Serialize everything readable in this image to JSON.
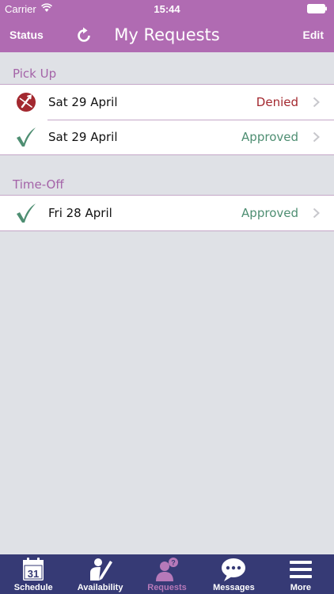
{
  "status_bar": {
    "carrier": "Carrier",
    "time": "15:44"
  },
  "nav": {
    "left_label": "Status",
    "title": "My Requests",
    "right_label": "Edit"
  },
  "sections": [
    {
      "title": "Pick Up",
      "rows": [
        {
          "date": "Sat 29 April",
          "status": "Denied",
          "icon": "denied-icon"
        },
        {
          "date": "Sat 29 April",
          "status": "Approved",
          "icon": "checkmark-icon"
        }
      ]
    },
    {
      "title": "Time-Off",
      "rows": [
        {
          "date": "Fri 28 April",
          "status": "Approved",
          "icon": "checkmark-icon"
        }
      ]
    }
  ],
  "tabs": [
    {
      "label": "Schedule",
      "icon": "calendar-icon",
      "calendar_day": "31"
    },
    {
      "label": "Availability",
      "icon": "person-writing-icon"
    },
    {
      "label": "Requests",
      "icon": "person-question-icon",
      "active": true
    },
    {
      "label": "Messages",
      "icon": "speech-bubble-icon"
    },
    {
      "label": "More",
      "icon": "menu-icon"
    }
  ],
  "colors": {
    "nav_bg": "#b06bb2",
    "section_title": "#a463a8",
    "denied": "#a3282f",
    "approved": "#4e8e72",
    "tabbar_bg": "#363a75",
    "active_tab": "#b679b9"
  }
}
